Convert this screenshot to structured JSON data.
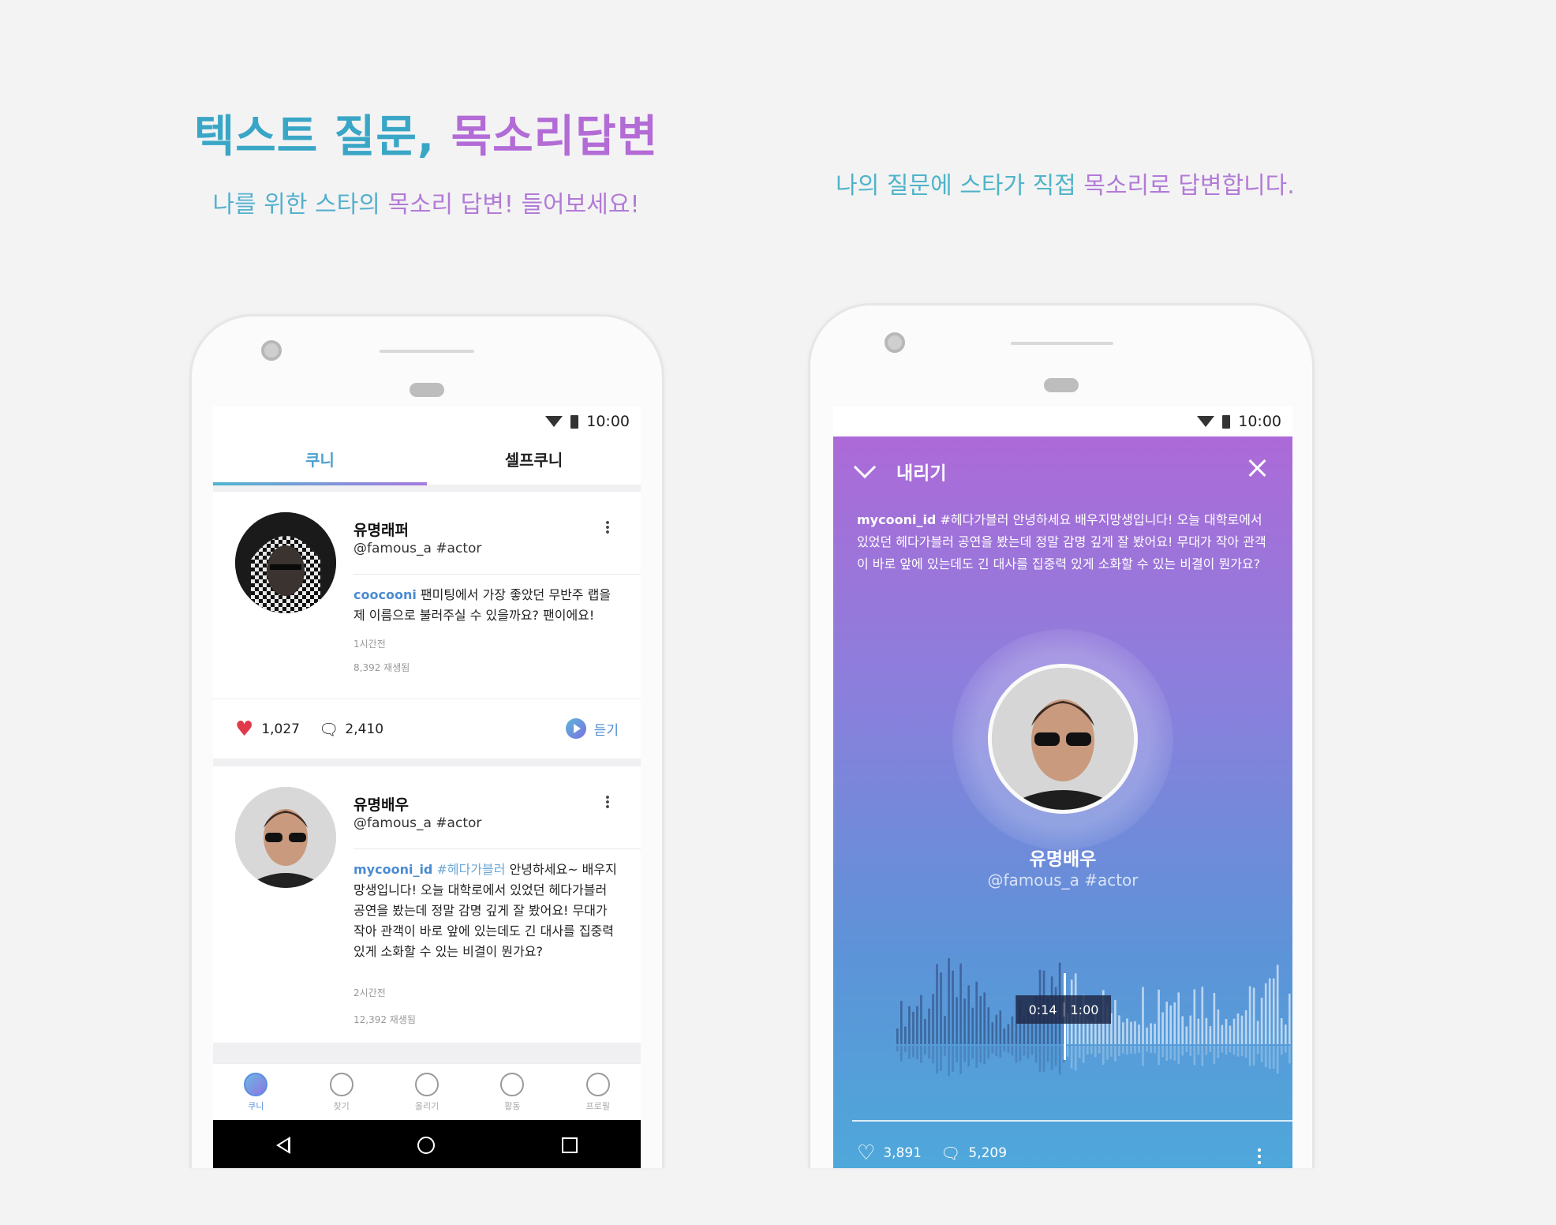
{
  "headline": {
    "part1": "텍스트 질문,",
    "part2": "목소리답변"
  },
  "subtitle_left": {
    "part1": "나를 위한 스타의",
    "part2": "목소리 답변! 들어보세요!"
  },
  "subtitle_right": {
    "part1": "나의 질문에 스타가 직접",
    "part2": "목소리로 답변합니다."
  },
  "left_phone": {
    "status_time": "10:00",
    "tabs": [
      {
        "label": "쿠니"
      },
      {
        "label": "셀프쿠니"
      }
    ],
    "cards": [
      {
        "name": "유명래퍼",
        "handle": "@famous_a #actor",
        "user": "coocooni",
        "text": " 팬미팅에서 가장 좋았던 무반주 랩을 제 이름으로 불러주실 수 있을까요? 팬이에요!",
        "time": "1시간전",
        "plays": "8,392 재생됨",
        "likes": "1,027",
        "comments": "2,410",
        "listen": "듣기"
      },
      {
        "name": "유명배우",
        "handle": "@famous_a #actor",
        "user": "mycooni_id",
        "tag": " #헤다가블러",
        "text": " 안녕하세요~ 배우지망생입니다! 오늘 대학로에서 있었던 헤다가블러 공연을 봤는데 정말 감명 깊게 잘 봤어요! 무대가 작아 관객이 바로 앞에 있는데도 긴 대사를 집중력 있게 소화할 수 있는 비결이 뭔가요?",
        "time": "2시간전",
        "plays": "12,392 재생됨"
      }
    ],
    "nav": [
      {
        "label": "쿠니",
        "icon": "home-bubble-icon"
      },
      {
        "label": "찾기",
        "icon": "search-icon"
      },
      {
        "label": "올리기",
        "icon": "plus-circle-icon"
      },
      {
        "label": "활동",
        "icon": "bell-icon"
      },
      {
        "label": "프로필",
        "icon": "profile-icon"
      }
    ]
  },
  "right_phone": {
    "status_time": "10:00",
    "header_title": "내리기",
    "question_user": "mycooni_id",
    "question_text": " #헤다가블러 안녕하세요 배우지망생입니다! 오늘 대학로에서 있었던 헤다가블러 공연을 봤는데 정말 감명 깊게 잘 봤어요! 무대가 작아 관객이 바로 앞에 있는데도 긴 대사를 집중력 있게 소화할 수 있는 비결이 뭔가요?",
    "name": "유명배우",
    "handle": "@famous_a #actor",
    "time_current": "0:14",
    "time_total": "1:00",
    "progress": 0.233,
    "likes": "3,891",
    "comments": "5,209"
  },
  "colors": {
    "accent_teal": "#3aa6c6",
    "accent_purple": "#b36bd6"
  }
}
